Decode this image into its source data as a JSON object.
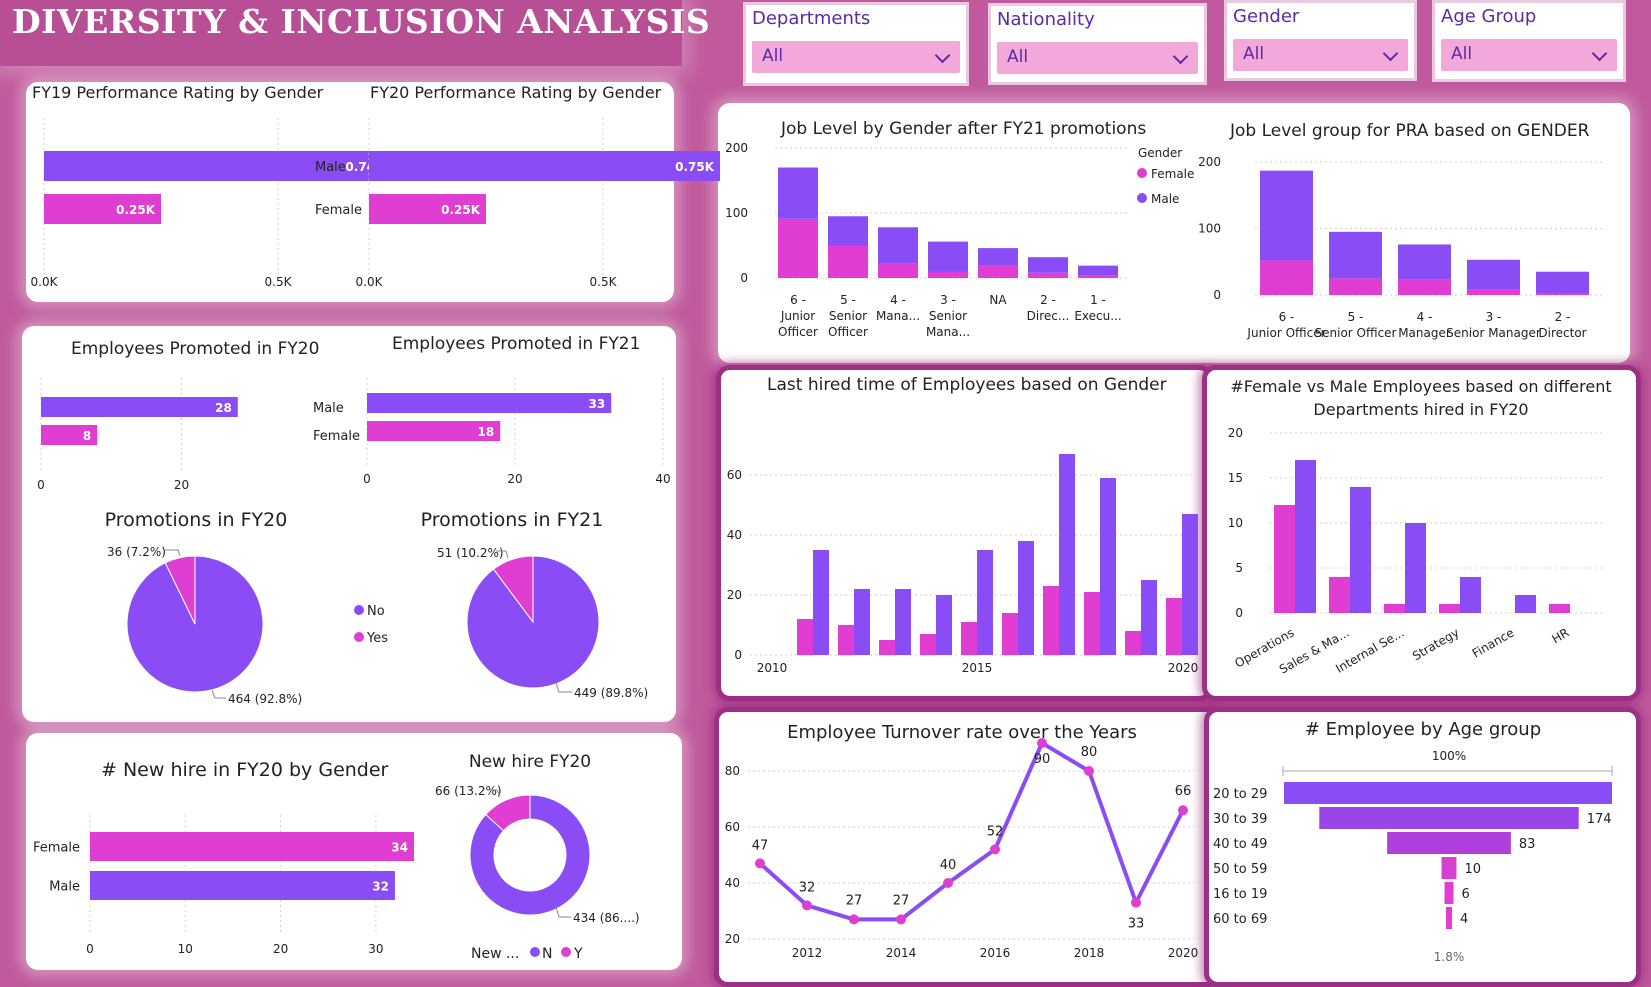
{
  "header": {
    "title": "DIVERSITY & INCLUSION ANALYSIS"
  },
  "filters": [
    {
      "label": "Departments",
      "value": "All"
    },
    {
      "label": "Nationality",
      "value": "All"
    },
    {
      "label": "Gender",
      "value": "All"
    },
    {
      "label": "Age Group",
      "value": "All"
    }
  ],
  "colors": {
    "male": "#8a4df5",
    "female": "#e03ed2",
    "bg": "#c05a9c",
    "text": "#222222",
    "axis": "#333333"
  },
  "chart_data": [
    {
      "id": "fy19_rating",
      "type": "bar",
      "title": "FY19 Performance Rating by Gender",
      "categories": [
        "Male",
        "Female"
      ],
      "values": [
        740,
        250
      ],
      "data_labels": [
        "0.74K",
        "0.25K"
      ],
      "xticks": [
        "0.0K",
        "0.5K"
      ],
      "xlim": [
        0,
        1000
      ]
    },
    {
      "id": "fy20_rating",
      "type": "bar",
      "title": "FY20 Performance Rating by Gender",
      "categories": [
        "Male",
        "Femal"
      ],
      "values": [
        750,
        250
      ],
      "data_labels": [
        "0.75K",
        "0.25K"
      ],
      "xticks": [
        "0.0K",
        "0.5K"
      ],
      "xlim": [
        0,
        1000
      ]
    },
    {
      "id": "promoted_fy20",
      "type": "bar",
      "title": "Employees Promoted in FY20",
      "categories": [
        "Male",
        "Female"
      ],
      "values": [
        28,
        8
      ],
      "xticks": [
        "0",
        "20"
      ],
      "xlim": [
        0,
        35
      ]
    },
    {
      "id": "promoted_fy21",
      "type": "bar",
      "title": "Employees Promoted in FY21",
      "categories": [
        "Male",
        "Female"
      ],
      "values": [
        33,
        18
      ],
      "xticks": [
        "0",
        "20",
        "40"
      ],
      "xlim": [
        0,
        40
      ]
    },
    {
      "id": "promotions_fy20_pie",
      "type": "pie",
      "title": "Promotions in FY20",
      "slices": [
        {
          "name": "No",
          "value": 464,
          "label": "464 (92.8%)"
        },
        {
          "name": "Yes",
          "value": 36,
          "label": "36 (7.2%)"
        }
      ]
    },
    {
      "id": "promotions_fy21_pie",
      "type": "pie",
      "title": "Promotions in FY21",
      "slices": [
        {
          "name": "No",
          "value": 449,
          "label": "449 (89.8%)"
        },
        {
          "name": "Yes",
          "value": 51,
          "label": "51 (10.2%)"
        }
      ]
    },
    {
      "id": "promotions_legend",
      "items": [
        "No",
        "Yes"
      ]
    },
    {
      "id": "new_hire_gender",
      "type": "bar",
      "title": "# New hire in FY20 by Gender",
      "categories": [
        "Female",
        "Male"
      ],
      "values": [
        34,
        32
      ],
      "xticks": [
        "0",
        "10",
        "20",
        "30"
      ],
      "xlim": [
        0,
        34
      ]
    },
    {
      "id": "new_hire_donut",
      "type": "pie",
      "title": "New hire FY20",
      "slices": [
        {
          "name": "N",
          "value": 434,
          "label": "434 (86....)"
        },
        {
          "name": "Y",
          "value": 66,
          "label": "66 (13.2%)"
        }
      ],
      "legend_title": "New ...",
      "legend": [
        "N",
        "Y"
      ]
    },
    {
      "id": "job_level",
      "type": "bar",
      "title": "Job Level by Gender after FY21 promotions",
      "categories": [
        "6 - Junior Officer",
        "5 - Senior Officer",
        "4 - Mana...",
        "3 - Senior Mana...",
        "NA",
        "2 - Direc...",
        "1 - Execu..."
      ],
      "series": [
        {
          "name": "Female",
          "values": [
            91,
            50,
            23,
            10,
            20,
            8,
            4
          ]
        },
        {
          "name": "Male",
          "values": [
            79,
            45,
            55,
            46,
            26,
            24,
            15
          ]
        }
      ],
      "yticks": [
        "0",
        "100",
        "200"
      ],
      "ylim": [
        0,
        200
      ],
      "legend_title": "Gender"
    },
    {
      "id": "job_level_pra",
      "type": "bar",
      "title": "Job Level group for PRA based on GENDER",
      "categories": [
        "6 - Junior Officer",
        "5 - Senior Officer",
        "4 - Manager",
        "3 - Senior Manager",
        "2 - Director"
      ],
      "series": [
        {
          "name": "Female",
          "values": [
            52,
            25,
            23,
            8,
            3
          ]
        },
        {
          "name": "Male",
          "values": [
            135,
            70,
            53,
            45,
            32
          ]
        }
      ],
      "yticks": [
        "0",
        "100",
        "200"
      ],
      "ylim": [
        0,
        200
      ]
    },
    {
      "id": "last_hired",
      "type": "bar",
      "title": "Last hired time of Employees based on Gender",
      "x": [
        2011,
        2012,
        2013,
        2014,
        2015,
        2016,
        2017,
        2018,
        2019,
        2020
      ],
      "series": [
        {
          "name": "Female",
          "values": [
            12,
            10,
            5,
            7,
            11,
            14,
            23,
            21,
            8,
            19
          ]
        },
        {
          "name": "Male",
          "values": [
            35,
            22,
            22,
            20,
            35,
            38,
            67,
            59,
            25,
            47
          ]
        }
      ],
      "yticks": [
        "0",
        "20",
        "40",
        "60"
      ],
      "xticks": [
        "2010",
        "2015",
        "2020"
      ],
      "ylim": [
        0,
        70
      ]
    },
    {
      "id": "dept_fy20",
      "type": "bar",
      "title": "#Female vs Male Employees based on different Departments hired in FY20",
      "categories": [
        "Operations",
        "Sales & Ma...",
        "Internal Se...",
        "Strategy",
        "Finance",
        "HR"
      ],
      "series": [
        {
          "name": "Female",
          "values": [
            12,
            4,
            1,
            1,
            0,
            1
          ]
        },
        {
          "name": "Male",
          "values": [
            17,
            14,
            10,
            4,
            2,
            0
          ]
        }
      ],
      "yticks": [
        "0",
        "5",
        "10",
        "15",
        "20"
      ],
      "ylim": [
        0,
        20
      ]
    },
    {
      "id": "turnover",
      "type": "line",
      "title": "Employee Turnover rate over the Years",
      "x": [
        2011,
        2012,
        2013,
        2014,
        2015,
        2016,
        2017,
        2018,
        2019,
        2020
      ],
      "values": [
        47,
        32,
        27,
        27,
        40,
        52,
        90,
        80,
        33,
        66
      ],
      "xticks": [
        "2012",
        "2014",
        "2016",
        "2018",
        "2020"
      ],
      "yticks": [
        "20",
        "40",
        "60",
        "80"
      ],
      "ylim": [
        20,
        95
      ]
    },
    {
      "id": "age_group",
      "type": "bar",
      "title": "# Employee by Age group",
      "categories": [
        "20 to 29",
        "30 to 39",
        "40 to 49",
        "50 to 59",
        "16 to 19",
        "60 to 69"
      ],
      "values": [
        220,
        174,
        83,
        10,
        6,
        4
      ],
      "data_labels": [
        "",
        "174",
        "83",
        "10",
        "6",
        "4"
      ],
      "top_label": "100%",
      "bottom_label": "1.8%"
    }
  ]
}
